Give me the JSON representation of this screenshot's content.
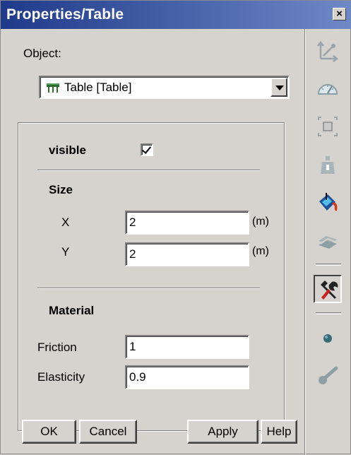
{
  "window": {
    "title": "Properties/Table",
    "close_label": "×"
  },
  "object": {
    "label": "Object:",
    "selected": "Table  [Table]"
  },
  "visible": {
    "label": "visible",
    "checked": true
  },
  "size": {
    "heading": "Size",
    "x_label": "X",
    "x_value": "2",
    "x_unit": "(m)",
    "y_label": "Y",
    "y_value": "2",
    "y_unit": "(m)"
  },
  "material": {
    "heading": "Material",
    "friction_label": "Friction",
    "friction_value": "1",
    "elasticity_label": "Elasticity",
    "elasticity_value": "0.9"
  },
  "buttons": {
    "ok": "OK",
    "cancel": "Cancel",
    "apply": "Apply",
    "help": "Help"
  },
  "toolbar": {
    "tools": [
      {
        "icon": "coordinates-icon"
      },
      {
        "icon": "gauge-icon"
      },
      {
        "icon": "resize-icon"
      },
      {
        "icon": "mass-icon"
      },
      {
        "icon": "paint-bucket-icon"
      },
      {
        "icon": "material-icon"
      },
      {
        "icon": "tools-icon",
        "active": true
      },
      {
        "icon": "point-icon"
      },
      {
        "icon": "joint-icon"
      }
    ]
  },
  "colors": {
    "title_start": "#1f3a8a",
    "title_end": "#6f88c6",
    "face": "#d6d3ce"
  }
}
